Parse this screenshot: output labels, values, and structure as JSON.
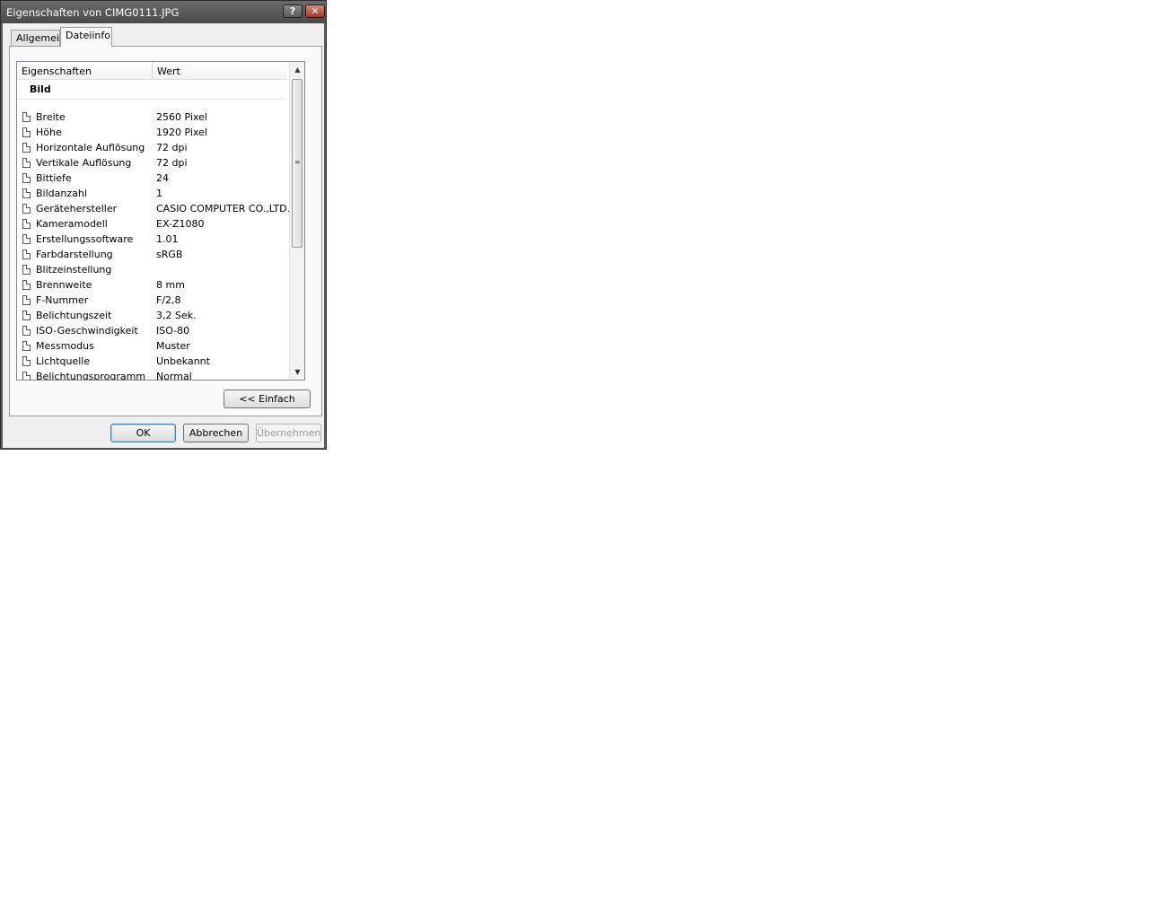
{
  "window": {
    "title": "Eigenschaften von CIMG0111.JPG",
    "help_button": "?",
    "close_button": "✕"
  },
  "tabs": [
    {
      "label": "Allgemein",
      "active": false
    },
    {
      "label": "Dateiinfo",
      "active": true
    }
  ],
  "list": {
    "columns": [
      "Eigenschaften",
      "Wert"
    ],
    "group": "Bild",
    "rows": [
      {
        "prop": "Breite",
        "value": "2560 Pixel"
      },
      {
        "prop": "Höhe",
        "value": "1920 Pixel"
      },
      {
        "prop": "Horizontale Auflösung",
        "value": "72 dpi"
      },
      {
        "prop": "Vertikale Auflösung",
        "value": "72 dpi"
      },
      {
        "prop": "Bittiefe",
        "value": "24"
      },
      {
        "prop": "Bildanzahl",
        "value": "1"
      },
      {
        "prop": "Gerätehersteller",
        "value": "CASIO COMPUTER CO.,LTD."
      },
      {
        "prop": "Kameramodell",
        "value": "EX-Z1080"
      },
      {
        "prop": "Erstellungssoftware",
        "value": "1.01"
      },
      {
        "prop": "Farbdarstellung",
        "value": "sRGB"
      },
      {
        "prop": "Blitzeinstellung",
        "value": ""
      },
      {
        "prop": "Brennweite",
        "value": "8 mm"
      },
      {
        "prop": "F-Nummer",
        "value": "F/2,8"
      },
      {
        "prop": "Belichtungszeit",
        "value": "3,2 Sek."
      },
      {
        "prop": "ISO-Geschwindigkeit",
        "value": "ISO-80"
      },
      {
        "prop": "Messmodus",
        "value": "Muster"
      },
      {
        "prop": "Lichtquelle",
        "value": "Unbekannt"
      },
      {
        "prop": "Belichtungsprogramm",
        "value": "Normal"
      }
    ]
  },
  "buttons": {
    "einfach": "<< Einfach",
    "ok": "OK",
    "abbrechen": "Abbrechen",
    "uebernehmen": "Übernehmen"
  },
  "icons": {
    "row_icon": "document-icon",
    "scroll_up": "▲",
    "scroll_down": "▼",
    "scroll_grip": "≡"
  }
}
